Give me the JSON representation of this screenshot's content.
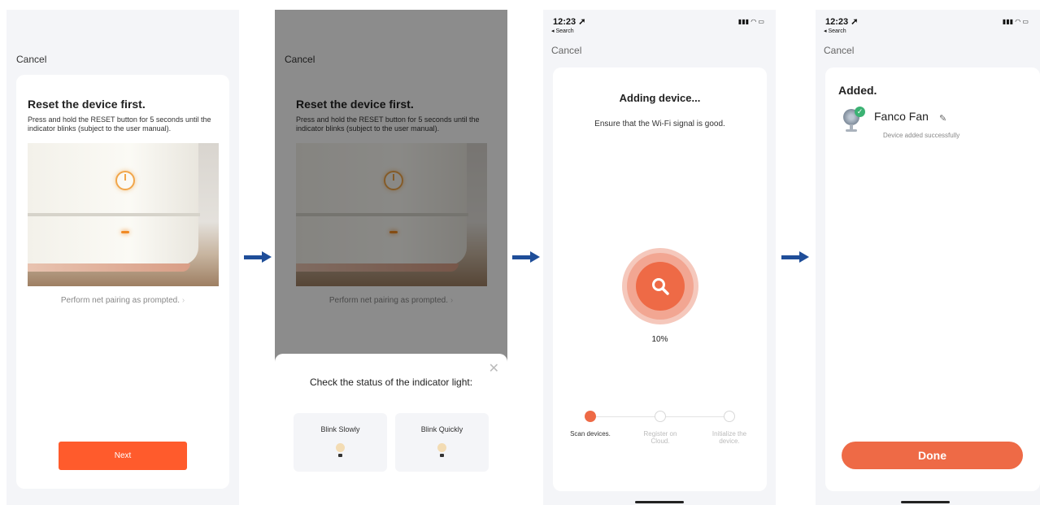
{
  "screen1": {
    "cancel": "Cancel",
    "title": "Reset the device first.",
    "description": "Press and hold the RESET button for 5 seconds until the indicator blinks (subject to the user manual).",
    "pairing_link": "Perform net pairing as prompted.",
    "next_button": "Next"
  },
  "screen2": {
    "cancel": "Cancel",
    "title": "Reset the device first.",
    "description": "Press and hold the RESET button for 5 seconds until the indicator blinks (subject to the user manual).",
    "pairing_link": "Perform net pairing as prompted.",
    "sheet_title": "Check the status of the indicator light:",
    "options": [
      "Blink Slowly",
      "Blink Quickly"
    ],
    "close_icon": "close-icon"
  },
  "screen3": {
    "status": {
      "time": "12:23",
      "back": "◂ Search"
    },
    "cancel": "Cancel",
    "title": "Adding device...",
    "subtitle": "Ensure that the Wi-Fi signal is good.",
    "progress": 10,
    "progress_label": "10%",
    "steps": [
      {
        "label": "Scan devices.",
        "state": "active"
      },
      {
        "label": "Register on Cloud.",
        "state": "idle"
      },
      {
        "label": "Initialize the device.",
        "state": "idle"
      }
    ]
  },
  "screen4": {
    "status": {
      "time": "12:23",
      "back": "◂ Search"
    },
    "cancel": "Cancel",
    "title": "Added.",
    "device_name": "Fanco Fan",
    "device_status": "Device added successfully",
    "done_button": "Done"
  },
  "colors": {
    "accent": "#ee6a46",
    "next_button": "#ff5b2c",
    "arrow": "#1f4e99",
    "success": "#3bb273"
  }
}
